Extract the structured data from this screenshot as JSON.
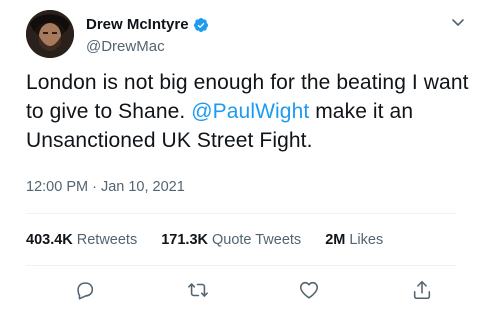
{
  "author": {
    "display_name": "Drew McIntyre",
    "handle": "@DrewMac",
    "verified": true
  },
  "tweet": {
    "text_part1": "London is not big enough for the beating I want to give to Shane. ",
    "mention": "@PaulWight",
    "text_part2": " make it an Unsanctioned UK Street Fight.",
    "timestamp": "12:00 PM · Jan 10, 2021"
  },
  "stats": {
    "retweets_count": "403.4K",
    "retweets_label": "Retweets",
    "quotes_count": "171.3K",
    "quotes_label": "Quote Tweets",
    "likes_count": "2M",
    "likes_label": "Likes"
  },
  "actions": {
    "reply_icon": "reply-icon",
    "retweet_icon": "retweet-icon",
    "like_icon": "heart-icon",
    "share_icon": "share-icon"
  },
  "colors": {
    "accent": "#1d9bf0",
    "text": "#0f1419",
    "secondary": "#536471",
    "divider": "#eff3f4"
  }
}
